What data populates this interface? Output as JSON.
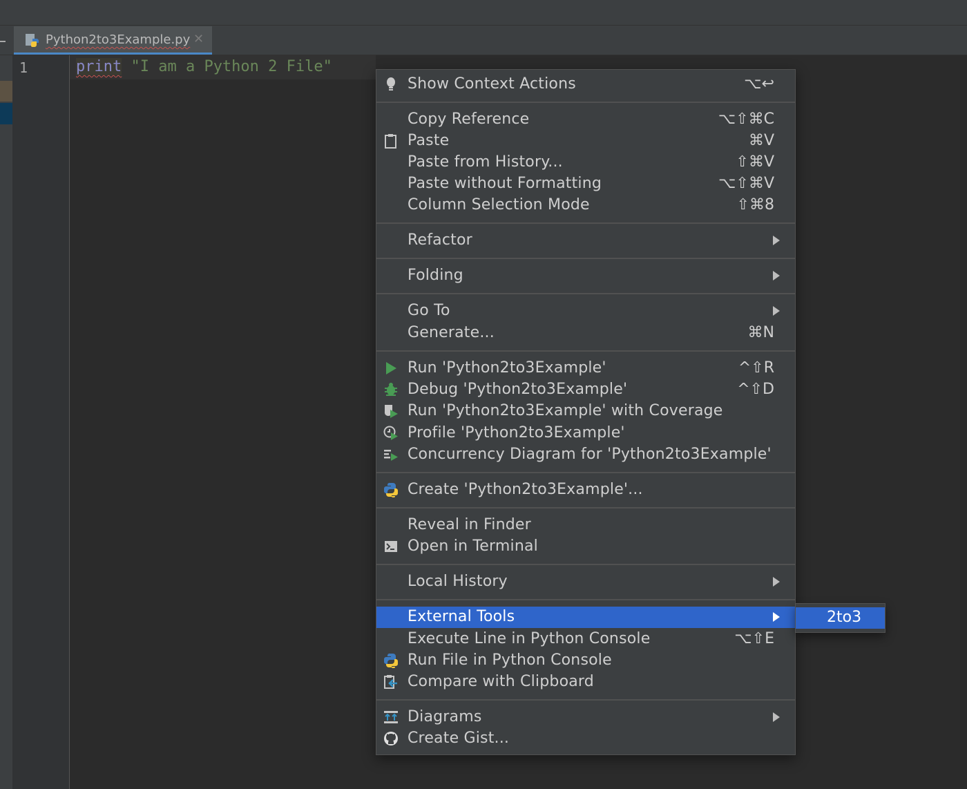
{
  "tab": {
    "filename": "Python2to3Example.py",
    "close_glyph": "✕"
  },
  "editor": {
    "line_number": "1",
    "code_keyword": "print",
    "code_string": "\"I am a Python 2 File\""
  },
  "menu": {
    "show_context_actions": {
      "label": "Show Context Actions",
      "shortcut": "⌥↩"
    },
    "copy_reference": {
      "label": "Copy Reference",
      "shortcut": "⌥⇧⌘C"
    },
    "paste": {
      "label": "Paste",
      "shortcut": "⌘V"
    },
    "paste_from_history": {
      "label": "Paste from History...",
      "shortcut": "⇧⌘V"
    },
    "paste_without_formatting": {
      "label": "Paste without Formatting",
      "shortcut": "⌥⇧⌘V"
    },
    "column_selection_mode": {
      "label": "Column Selection Mode",
      "shortcut": "⇧⌘8"
    },
    "refactor": {
      "label": "Refactor"
    },
    "folding": {
      "label": "Folding"
    },
    "go_to": {
      "label": "Go To"
    },
    "generate": {
      "label": "Generate...",
      "shortcut": "⌘N"
    },
    "run": {
      "label": "Run 'Python2to3Example'",
      "shortcut": "^⇧R"
    },
    "debug": {
      "label": "Debug 'Python2to3Example'",
      "shortcut": "^⇧D"
    },
    "run_coverage": {
      "label": "Run 'Python2to3Example' with Coverage"
    },
    "profile": {
      "label": "Profile 'Python2to3Example'"
    },
    "concurrency": {
      "label": "Concurrency Diagram for 'Python2to3Example'"
    },
    "create_config": {
      "label": "Create 'Python2to3Example'..."
    },
    "reveal_in_finder": {
      "label": "Reveal in Finder"
    },
    "open_in_terminal": {
      "label": "Open in Terminal"
    },
    "local_history": {
      "label": "Local History"
    },
    "external_tools": {
      "label": "External Tools"
    },
    "execute_line": {
      "label": "Execute Line in Python Console",
      "shortcut": "⌥⇧E"
    },
    "run_file_console": {
      "label": "Run File in Python Console"
    },
    "compare_clipboard": {
      "label": "Compare with Clipboard"
    },
    "diagrams": {
      "label": "Diagrams"
    },
    "create_gist": {
      "label": "Create Gist..."
    }
  },
  "submenu": {
    "item_2to3": "2to3"
  },
  "colors": {
    "menu_bg": "#3c3f41",
    "highlight": "#2f65ca",
    "editor_bg": "#2b2b2b",
    "keyword": "#8888c6",
    "string": "#6a8759",
    "run_green": "#499c54"
  }
}
